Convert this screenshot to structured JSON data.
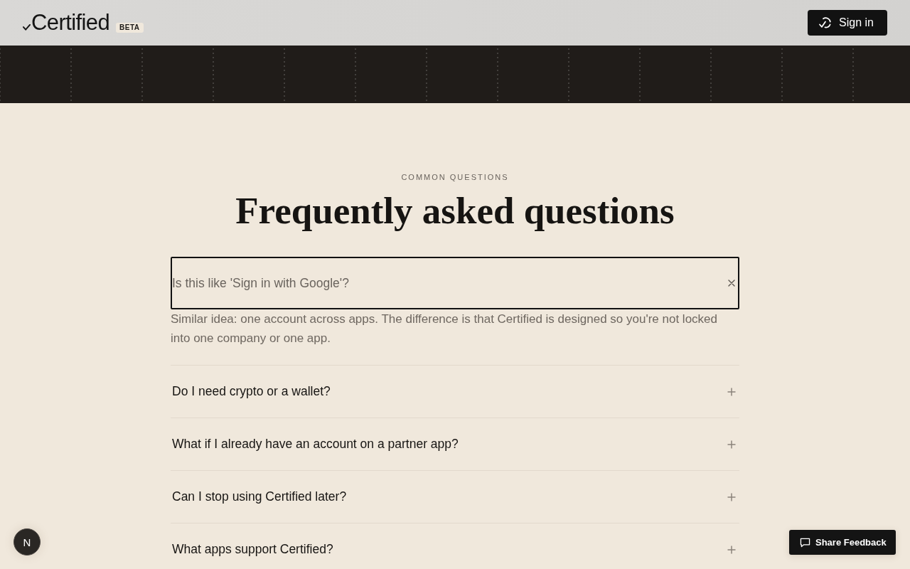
{
  "header": {
    "logo": "Certified",
    "badge": "BETA",
    "sign_in_button": "Sign in"
  },
  "faq": {
    "eyebrow": "COMMON QUESTIONS",
    "title": "Frequently asked questions",
    "items": [
      {
        "question": "Is this like 'Sign in with Google'?",
        "expanded": true,
        "answer": "Similar idea: one account across apps. The difference is that Certified is designed so you're not locked into one company or one app."
      },
      {
        "question": "Do I need crypto or a wallet?",
        "expanded": false
      },
      {
        "question": "What if I already have an account on a partner app?",
        "expanded": false
      },
      {
        "question": "Can I stop using Certified later?",
        "expanded": false
      },
      {
        "question": "What apps support Certified?",
        "expanded": false
      }
    ]
  },
  "floating_button": "N",
  "feedback_button": "Share Feedback"
}
